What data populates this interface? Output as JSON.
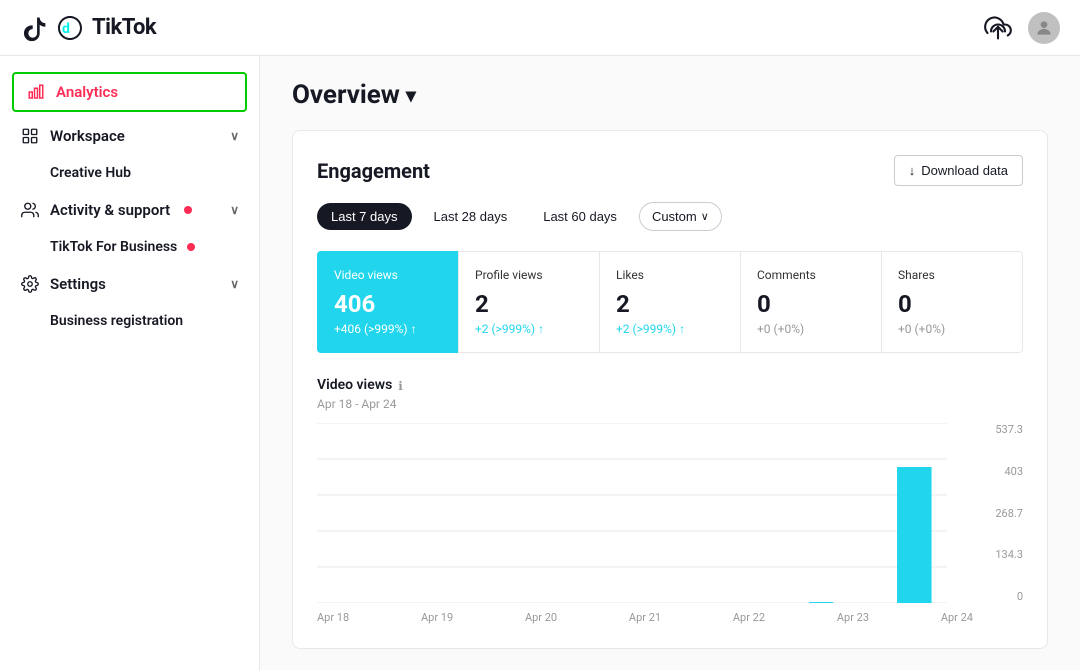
{
  "header": {
    "logo_text": "TikTok",
    "upload_icon": "upload-icon",
    "avatar_icon": "avatar-icon"
  },
  "sidebar": {
    "items": [
      {
        "id": "analytics",
        "label": "Analytics",
        "icon": "bar-chart-icon",
        "active": true,
        "hasChevron": false,
        "hasDot": false
      },
      {
        "id": "workspace",
        "label": "Workspace",
        "icon": "workspace-icon",
        "active": false,
        "hasChevron": true,
        "hasDot": false
      },
      {
        "id": "creative-hub",
        "label": "Creative Hub",
        "icon": null,
        "active": false,
        "hasChevron": false,
        "hasDot": false,
        "sub": true
      },
      {
        "id": "activity-support",
        "label": "Activity & support",
        "icon": "activity-icon",
        "active": false,
        "hasChevron": true,
        "hasDot": true
      },
      {
        "id": "tiktok-for-business",
        "label": "TikTok For Business",
        "icon": null,
        "active": false,
        "hasChevron": false,
        "hasDot": true,
        "sub": true
      },
      {
        "id": "settings",
        "label": "Settings",
        "icon": "settings-icon",
        "active": false,
        "hasChevron": true,
        "hasDot": false
      },
      {
        "id": "business-registration",
        "label": "Business registration",
        "icon": null,
        "active": false,
        "hasChevron": false,
        "hasDot": false,
        "sub": true
      }
    ]
  },
  "page": {
    "title": "Overview",
    "title_chevron": "▾"
  },
  "engagement": {
    "section_title": "Engagement",
    "download_label": "Download data",
    "date_tabs": [
      {
        "id": "7days",
        "label": "Last 7 days",
        "active": true
      },
      {
        "id": "28days",
        "label": "Last 28 days",
        "active": false
      },
      {
        "id": "60days",
        "label": "Last 60 days",
        "active": false
      },
      {
        "id": "custom",
        "label": "Custom",
        "active": false
      }
    ],
    "metrics": [
      {
        "id": "video-views",
        "label": "Video views",
        "value": "406",
        "change": "+406 (>999%)",
        "change_icon": "↑",
        "highlighted": true
      },
      {
        "id": "profile-views",
        "label": "Profile views",
        "value": "2",
        "change": "+2 (>999%)",
        "change_icon": "↑",
        "highlighted": false
      },
      {
        "id": "likes",
        "label": "Likes",
        "value": "2",
        "change": "+2 (>999%)",
        "change_icon": "↑",
        "highlighted": false
      },
      {
        "id": "comments",
        "label": "Comments",
        "value": "0",
        "change": "+0 (+0%)",
        "change_icon": "",
        "highlighted": false
      },
      {
        "id": "shares",
        "label": "Shares",
        "value": "0",
        "change": "+0 (+0%)",
        "change_icon": "",
        "highlighted": false
      }
    ],
    "chart": {
      "label": "Video views",
      "info_icon": "ℹ",
      "date_range": "Apr 18 - Apr 24",
      "y_labels": [
        "537.3",
        "403",
        "268.7",
        "134.3",
        "0"
      ],
      "x_labels": [
        "Apr 18",
        "Apr 19",
        "Apr 20",
        "Apr 21",
        "Apr 22",
        "Apr 23",
        "Apr 24"
      ],
      "bar_data": [
        {
          "date": "Apr 18",
          "value": 0
        },
        {
          "date": "Apr 19",
          "value": 0
        },
        {
          "date": "Apr 20",
          "value": 0
        },
        {
          "date": "Apr 21",
          "value": 0
        },
        {
          "date": "Apr 22",
          "value": 0
        },
        {
          "date": "Apr 23",
          "value": 2
        },
        {
          "date": "Apr 24",
          "value": 406
        }
      ],
      "max_value": 537.3
    }
  }
}
